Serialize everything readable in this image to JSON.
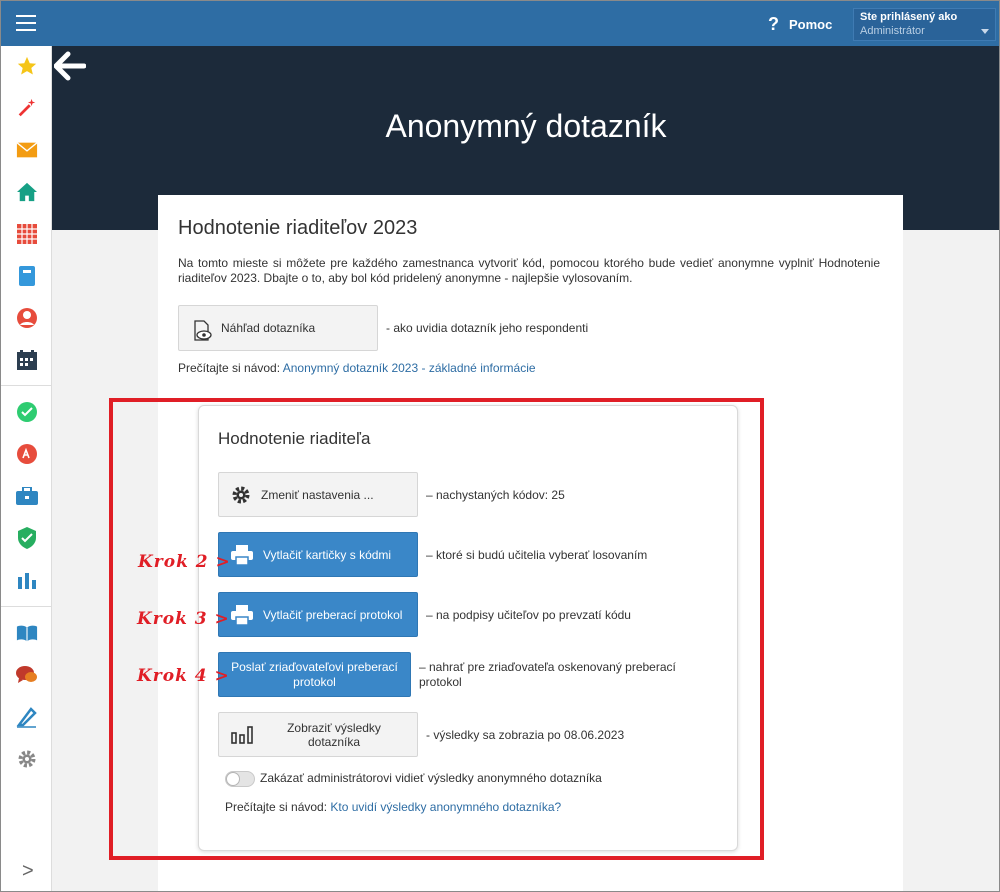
{
  "topbar": {
    "help_label": "Pomoc",
    "help_icon": "?",
    "user_line1": "Ste prihlásený ako",
    "user_line2": "Administrátor"
  },
  "sidebar": {
    "icons": [
      "star-icon",
      "magic-wand-icon",
      "envelope-icon",
      "home-icon",
      "calendar-grid-icon",
      "notebook-icon",
      "user-icon",
      "schedule-icon",
      "check-circle-icon",
      "grade-icon",
      "briefcase-icon",
      "shield-check-icon",
      "bar-chart-icon",
      "book-icon",
      "chat-icon",
      "pen-icon",
      "gear-icon"
    ],
    "expand_glyph": ">"
  },
  "hero": {
    "title": "Anonymný dotazník"
  },
  "card": {
    "title": "Hodnotenie riaditeľov 2023",
    "description": "Na tomto mieste si môžete pre každého zamestnanca vytvoriť kód, pomocou ktorého bude vedieť anonymne vyplniť Hodnotenie riaditeľov 2023. Dbajte o to, aby bol kód pridelený anonymne - najlepšie vylosovaním.",
    "preview_button": "Náhľad dotazníka",
    "preview_note": "- ako uvidia dotazník jeho respondenti",
    "guide_prefix": "Prečítajte si návod:",
    "guide_link": "Anonymný dotazník 2023 - základné informácie"
  },
  "panel": {
    "title": "Hodnotenie riaditeľa",
    "settings_button": "Zmeniť nastavenia ...",
    "settings_note": "– nachystaných kódov: 25",
    "print_cards_button": "Vytlačiť kartičky s kódmi",
    "print_cards_note": "– ktoré si budú učitelia vyberať losovaním",
    "print_protocol_button": "Vytlačiť preberací protokol",
    "print_protocol_note": "– na podpisy učiteľov po prevzatí kódu",
    "send_protocol_button": "Poslať zriaďovateľovi preberací protokol",
    "send_protocol_note": "– nahrať pre zriaďovateľa oskenovaný preberací protokol",
    "results_button": "Zobraziť výsledky dotazníka",
    "results_note": "- výsledky sa zobrazia po 08.06.2023",
    "toggle_label": "Zakázať administrátorovi vidieť výsledky anonymného dotazníka",
    "toggle_on": false,
    "guide_prefix": "Prečítajte si návod:",
    "guide_link": "Kto uvidí výsledky anonymného dotazníka?"
  },
  "annotations": {
    "step2": "Krok 2 >",
    "step3": "Krok 3 >",
    "step4": "Krok 4 >",
    "color": "#e01e26"
  },
  "colors": {
    "topbar": "#2e6da4",
    "hero": "#1c2a3a",
    "primary_button": "#3a87c8"
  }
}
